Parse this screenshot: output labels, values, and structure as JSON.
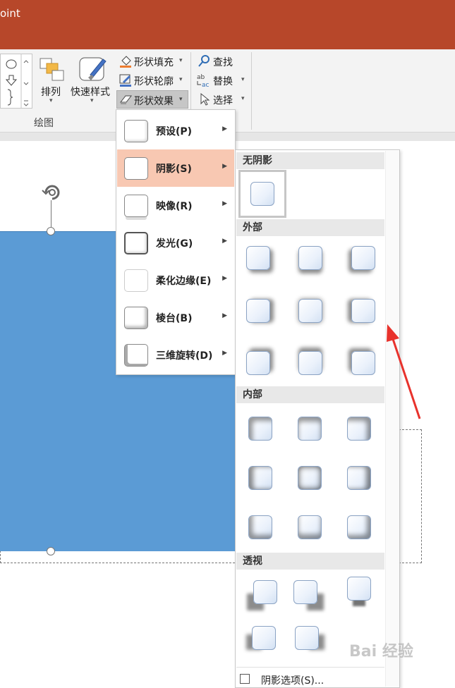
{
  "app": {
    "title_fragment": "oint"
  },
  "ribbon": {
    "arrange_label": "排列",
    "quick_styles_label": "快速样式",
    "shape_fill_label": "形状填充",
    "shape_outline_label": "形状轮廓",
    "shape_effects_label": "形状效果",
    "drawing_group_label": "绘图",
    "find_label": "查找",
    "replace_label": "替换",
    "select_label": "选择"
  },
  "effects_menu": {
    "items": [
      {
        "label": "预设(P)"
      },
      {
        "label": "阴影(S)"
      },
      {
        "label": "映像(R)"
      },
      {
        "label": "发光(G)"
      },
      {
        "label": "柔化边缘(E)"
      },
      {
        "label": "棱台(B)"
      },
      {
        "label": "三维旋转(D)"
      }
    ],
    "active_index": 1
  },
  "shadow_menu": {
    "sections": {
      "no_shadow": "无阴影",
      "outer": "外部",
      "inner": "内部",
      "perspective": "透视"
    },
    "options_label": "阴影选项(S)..."
  },
  "watermark": "Bai 经验",
  "colors": {
    "title_bar": "#b7472a",
    "shape_fill": "#5b9bd5",
    "menu_highlight": "#f8c8b2",
    "annotation_arrow": "#e8322c"
  }
}
